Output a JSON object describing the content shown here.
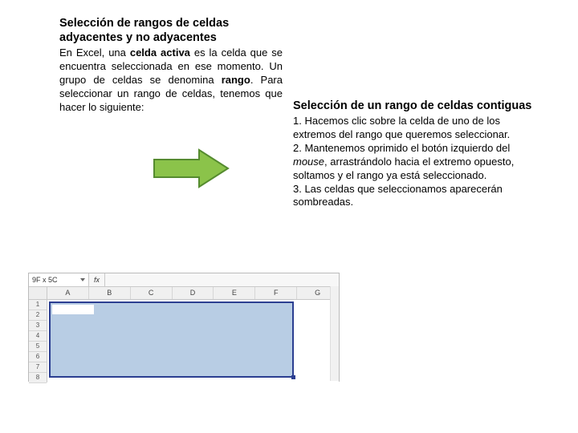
{
  "left": {
    "heading": "Selección de rangos de celdas adyacentes y no adyacentes",
    "p1a": "En Excel, una ",
    "p1b": "celda activa",
    "p1c": " es la celda que se encuentra seleccionada en ese momento. Un grupo de celdas se denomina ",
    "p1d": "rango",
    "p1e": ". Para seleccionar un rango de celdas, tenemos que hacer lo siguiente:"
  },
  "right": {
    "heading": "Selección de un rango de celdas contiguas",
    "s1": "1. Hacemos clic sobre la celda de uno de los extremos del rango que queremos seleccionar.",
    "s2a": "2. Mantenemos oprimido el botón izquierdo del ",
    "s2b": "mouse",
    "s2c": ", arrastrándolo hacia el extremo opuesto, soltamos y el rango ya está seleccionado.",
    "s3": "3. Las celdas que seleccionamos aparecerán sombreadas."
  },
  "excel": {
    "namebox": "9F x 5C",
    "fx": "fx",
    "cols": [
      "A",
      "B",
      "C",
      "D",
      "E",
      "F",
      "G"
    ],
    "rows": [
      "1",
      "2",
      "3",
      "4",
      "5",
      "6",
      "7",
      "8"
    ]
  },
  "colors": {
    "arrow_fill": "#8bc34a",
    "arrow_stroke": "#558b2f"
  }
}
